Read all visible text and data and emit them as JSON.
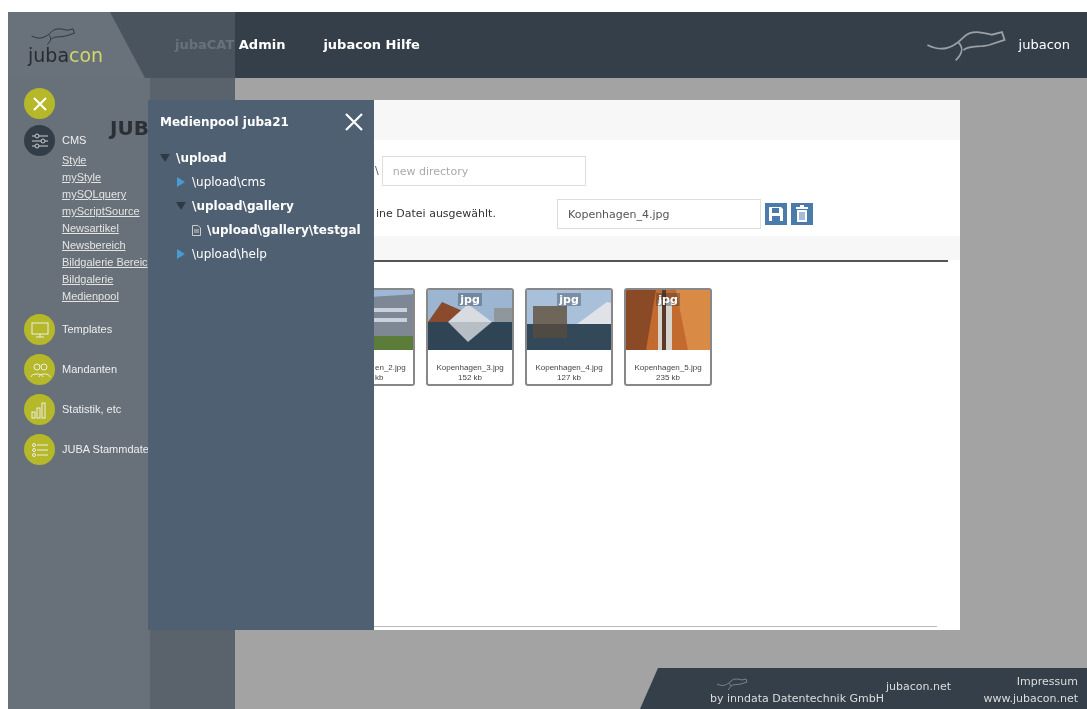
{
  "header": {
    "logo": {
      "parts": [
        "juba",
        "con"
      ]
    },
    "nav": [
      {
        "label": "jubaCAT Admin"
      },
      {
        "label": "jubacon Hilfe"
      }
    ],
    "brand": "jubacon"
  },
  "page": {
    "heading": "JUB"
  },
  "sidebar": {
    "menu": [
      {
        "label": "CMS",
        "selected": true,
        "children": [
          {
            "label": "Style"
          },
          {
            "label": "myStyle"
          },
          {
            "label": "mySQLquery"
          },
          {
            "label": "myScriptSource"
          },
          {
            "label": "Newsartikel"
          },
          {
            "label": "Newsbereich"
          },
          {
            "label": "Bildgalerie Bereic"
          },
          {
            "label": "Bildgalerie"
          },
          {
            "label": "Medienpool"
          }
        ]
      },
      {
        "label": "Templates",
        "selected": false
      },
      {
        "label": "Mandanten",
        "selected": false
      },
      {
        "label": "Statistik, etc",
        "selected": false
      },
      {
        "label": "JUBA Stammdate",
        "selected": false
      }
    ]
  },
  "medienpool": {
    "path": "\\",
    "new_dir": {
      "placeholder": "new directory"
    },
    "no_file": "ine Datei ausgewählt.",
    "filename": {
      "value": "Kopenhagen_4.jpg"
    },
    "files": [
      {
        "kind": "clipped",
        "name": "en_2.jpg",
        "size": "kb"
      },
      {
        "kind": "full",
        "type_label": "jpg",
        "name": "Kopenhagen_3.jpg",
        "size": "152 kb"
      },
      {
        "kind": "full",
        "type_label": "jpg",
        "name": "Kopenhagen_4.jpg",
        "size": "127 kb"
      },
      {
        "kind": "full",
        "type_label": "jpg",
        "name": "Kopenhagen_5.jpg",
        "size": "235 kb"
      }
    ]
  },
  "dialog": {
    "title": "Medienpool juba21",
    "tree": [
      {
        "label": "\\upload",
        "kind": "folder",
        "expanded": true,
        "selected": true,
        "children": [
          {
            "label": "\\upload\\cms",
            "kind": "folder",
            "expanded": false,
            "selected": false
          },
          {
            "label": "\\upload\\gallery",
            "kind": "folder",
            "expanded": true,
            "selected": true,
            "children": [
              {
                "label": "\\upload\\gallery\\testgal",
                "kind": "file",
                "selected": true
              }
            ]
          },
          {
            "label": "\\upload\\help",
            "kind": "folder",
            "expanded": false,
            "selected": false
          }
        ]
      }
    ]
  },
  "footer": {
    "company": "by inndata Datentechnik GmbH",
    "site": "jubacon.net",
    "imprint": "Impressum",
    "url": "www.jubacon.net"
  }
}
